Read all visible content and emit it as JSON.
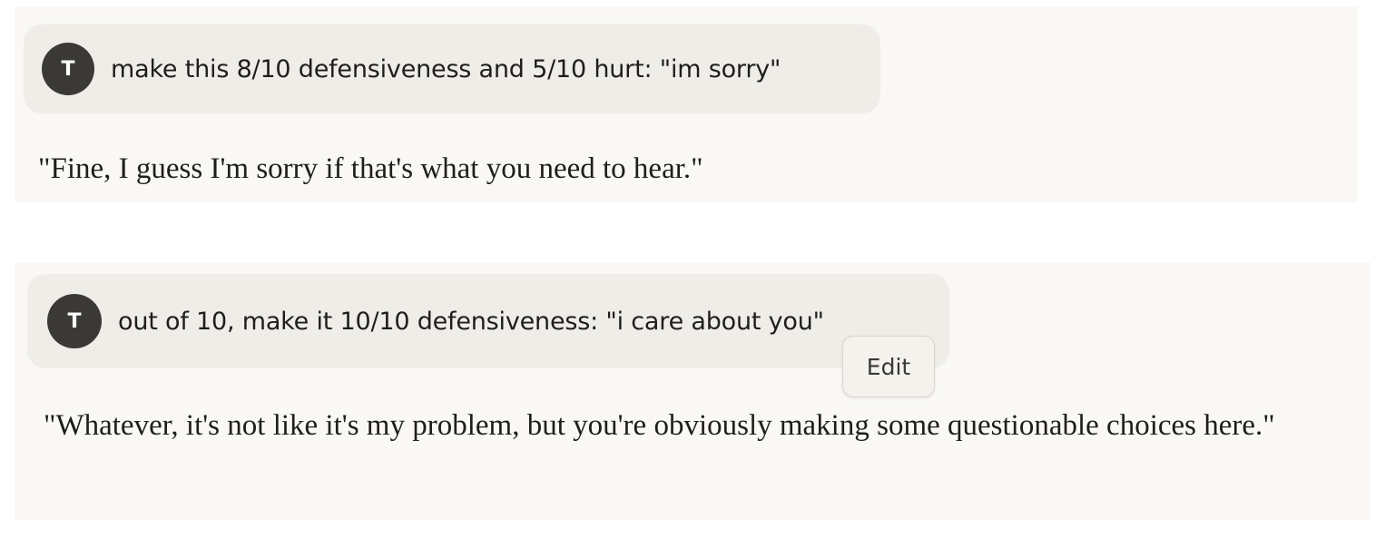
{
  "messages": [
    {
      "avatar_initial": "T",
      "user_text": "make this 8/10 defensiveness and 5/10 hurt: \"im sorry\"",
      "reply": "\"Fine, I guess I'm sorry if that's what you need to hear.\""
    },
    {
      "avatar_initial": "T",
      "user_text": "out of 10, make it 10/10 defensiveness: \"i care about you\"",
      "reply": "\"Whatever, it's not like it's my problem, but you're obviously making some questionable choices here.\"",
      "edit_label": "Edit"
    }
  ]
}
